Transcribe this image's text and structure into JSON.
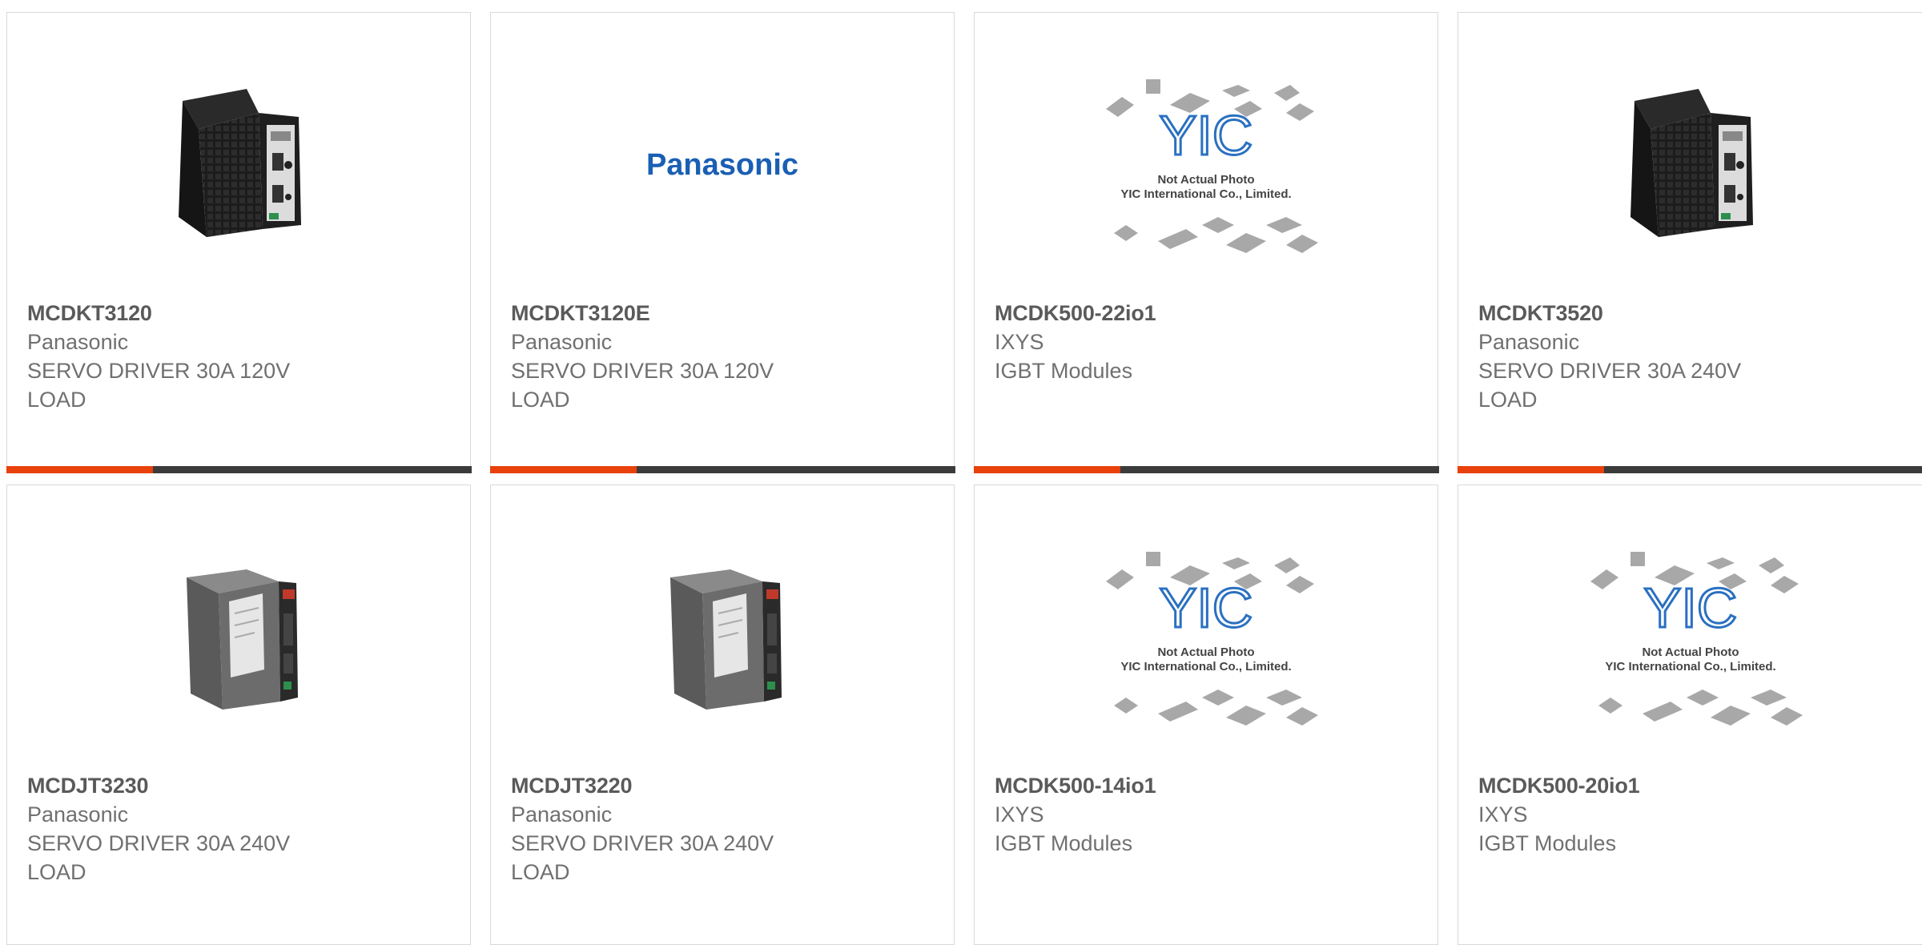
{
  "products": [
    {
      "part_number": "MCDKT3120",
      "manufacturer": "Panasonic",
      "description": "SERVO DRIVER 30A 120V\nLOAD",
      "image": "servo-drive-black-icon"
    },
    {
      "part_number": "MCDKT3120E",
      "manufacturer": "Panasonic",
      "description": "SERVO DRIVER 30A 120V\nLOAD",
      "image": "panasonic-logo",
      "logo_text": "Panasonic",
      "logo_color": "#1a5fb4"
    },
    {
      "part_number": "MCDK500-22io1",
      "manufacturer": "IXYS",
      "description": "IGBT Modules",
      "image": "placeholder-not-actual-photo",
      "placeholder_logo": "YIC",
      "placeholder_line1": "Not Actual Photo",
      "placeholder_line2": "YIC International Co., Limited."
    },
    {
      "part_number": "MCDKT3520",
      "manufacturer": "Panasonic",
      "description": "SERVO DRIVER 30A 240V\nLOAD",
      "image": "servo-drive-black-icon"
    },
    {
      "part_number": "MCDJT3230",
      "manufacturer": "Panasonic",
      "description": "SERVO DRIVER 30A 240V\nLOAD",
      "image": "servo-drive-grey-icon"
    },
    {
      "part_number": "MCDJT3220",
      "manufacturer": "Panasonic",
      "description": "SERVO DRIVER 30A 240V\nLOAD",
      "image": "servo-drive-grey-icon"
    },
    {
      "part_number": "MCDK500-14io1",
      "manufacturer": "IXYS",
      "description": "IGBT Modules",
      "image": "placeholder-not-actual-photo",
      "placeholder_logo": "YIC",
      "placeholder_line1": "Not Actual Photo",
      "placeholder_line2": "YIC International Co., Limited."
    },
    {
      "part_number": "MCDK500-20io1",
      "manufacturer": "IXYS",
      "description": "IGBT Modules",
      "image": "placeholder-not-actual-photo",
      "placeholder_logo": "YIC",
      "placeholder_line1": "Not Actual Photo",
      "placeholder_line2": "YIC International Co., Limited."
    }
  ],
  "colors": {
    "accent": "#e8410b",
    "bar_dark": "#3b3b3b",
    "card_border": "#d9d9d9",
    "title_text": "#5a5a5a",
    "body_text": "#707070"
  }
}
